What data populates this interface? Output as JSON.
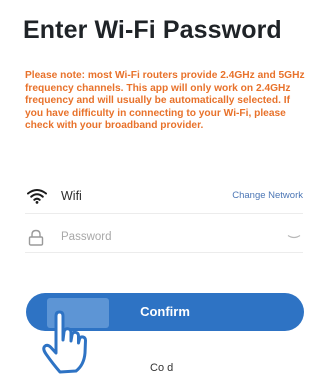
{
  "header": {
    "title": "Enter Wi-Fi Password"
  },
  "notice": {
    "text": "Please note: most Wi-Fi routers provide 2.4GHz and 5GHz frequency channels. This app will only work on 2.4GHz frequency and will usually be automatically selected. If you have difficulty in connecting to your Wi-Fi, please check with your broadband provider.",
    "color": "#e8722b"
  },
  "network": {
    "icon": "wifi-icon",
    "name": "Wifi",
    "change_label": "Change Network"
  },
  "password": {
    "icon": "lock-icon",
    "placeholder": "Password",
    "value": "",
    "toggle_icon": "eye-closed-icon"
  },
  "confirm": {
    "label": "Confirm",
    "color": "#2e73c4"
  },
  "pointer": {
    "icon": "hand-pointer-icon"
  },
  "footer": {
    "caption": "Co d"
  }
}
